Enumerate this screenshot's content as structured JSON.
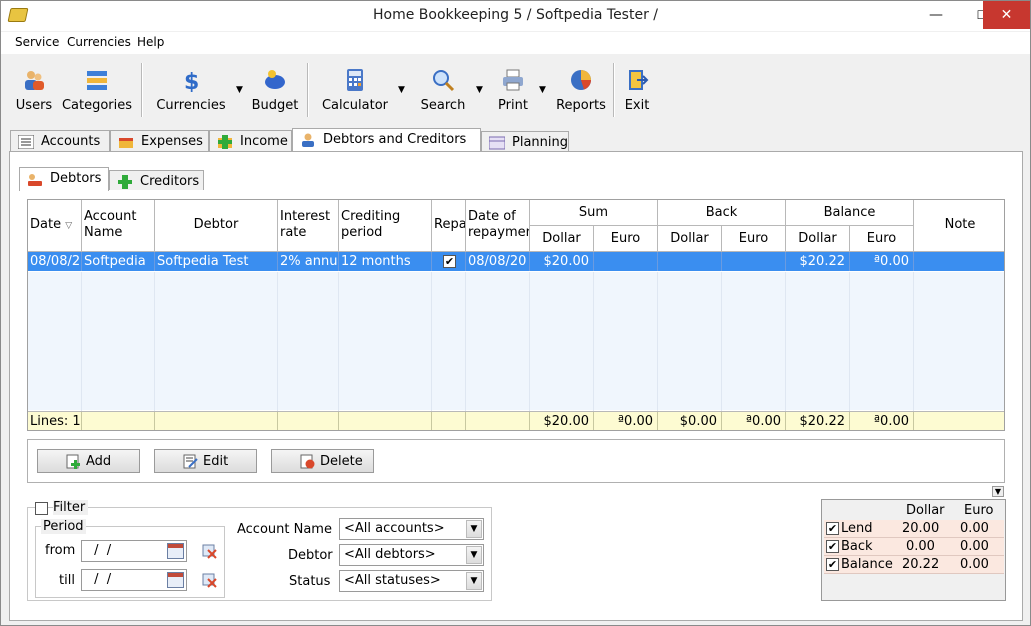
{
  "window": {
    "title": "Home Bookkeeping 5  / Softpedia Tester /",
    "minimize": "—",
    "maximize": "☐",
    "close": "✕"
  },
  "menu": [
    "Service",
    "Currencies",
    "Help"
  ],
  "toolbar": [
    {
      "label": "Users",
      "icon": "users-icon"
    },
    {
      "label": "Categories",
      "icon": "categories-icon"
    },
    {
      "label": "Currencies",
      "icon": "currencies-icon"
    },
    {
      "label": "Budget",
      "icon": "budget-icon"
    },
    {
      "label": "Calculator",
      "icon": "calculator-icon"
    },
    {
      "label": "Search",
      "icon": "search-icon"
    },
    {
      "label": "Print",
      "icon": "print-icon"
    },
    {
      "label": "Reports",
      "icon": "reports-icon"
    },
    {
      "label": "Exit",
      "icon": "exit-icon"
    }
  ],
  "tabs": [
    "Accounts",
    "Expenses",
    "Income",
    "Debtors and Creditors",
    "Planning"
  ],
  "subtabs": [
    "Debtors",
    "Creditors"
  ],
  "grid": {
    "headers": {
      "date": "Date",
      "account": "Account Name",
      "debtor": "Debtor",
      "interest": "Interest rate",
      "crediting": "Crediting period",
      "repaid": "Repa",
      "repaydate": "Date of repaymer",
      "sum": "Sum",
      "back": "Back",
      "balance": "Balance",
      "note": "Note",
      "dollar": "Dollar",
      "euro": "Euro"
    },
    "row": {
      "date": "08/08/2",
      "account": "Softpedia",
      "debtor": "Softpedia Test",
      "interest": "2% annu",
      "crediting": "12 months",
      "repaid": "✔",
      "repaydate": "08/08/20",
      "sum_dollar": "$20.00",
      "sum_euro": "",
      "back_dollar": "",
      "back_euro": "",
      "bal_dollar": "$20.22",
      "bal_euro": "ª0.00",
      "note": ""
    },
    "footer": {
      "lines": "Lines: 1",
      "sum_dollar": "$20.00",
      "sum_euro": "ª0.00",
      "back_dollar": "$0.00",
      "back_euro": "ª0.00",
      "bal_dollar": "$20.22",
      "bal_euro": "ª0.00"
    }
  },
  "buttons": {
    "add": "Add",
    "edit": "Edit",
    "delete": "Delete"
  },
  "filter": {
    "label": "Filter",
    "period": "Period",
    "from": "from",
    "till": "till",
    "from_value": " /  /",
    "till_value": " /  /",
    "account_label": "Account Name",
    "account_value": "<All accounts>",
    "debtor_label": "Debtor",
    "debtor_value": "<All debtors>",
    "status_label": "Status",
    "status_value": "<All statuses>"
  },
  "summary": {
    "col_dollar": "Dollar",
    "col_euro": "Euro",
    "rows": [
      {
        "label": "Lend",
        "dollar": "20.00",
        "euro": "0.00"
      },
      {
        "label": "Back",
        "dollar": "0.00",
        "euro": "0.00"
      },
      {
        "label": "Balance",
        "dollar": "20.22",
        "euro": "0.00"
      }
    ]
  }
}
